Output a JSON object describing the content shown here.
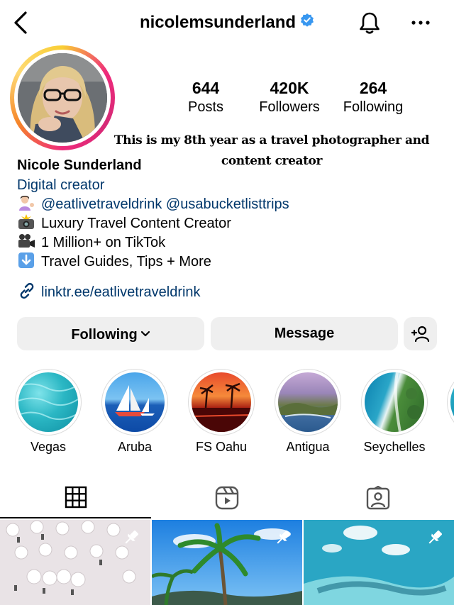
{
  "header": {
    "username": "nicolemsunderland",
    "verified": true,
    "icons": [
      "back-arrow-icon",
      "verified-badge-icon",
      "bell-icon",
      "more-dots-icon"
    ]
  },
  "stats": [
    {
      "value": "644",
      "label": "Posts"
    },
    {
      "value": "420K",
      "label": "Followers"
    },
    {
      "value": "264",
      "label": "Following"
    }
  ],
  "caption_overlay": "This is my 8th year as a travel photographer and content creator",
  "profile": {
    "name": "Nicole Sunderland",
    "category": "Digital creator",
    "bio": [
      {
        "emoji": "woman-tipping-hand-icon",
        "text": "@eatlivetraveldrink @usabucketlisttrips"
      },
      {
        "emoji": "camera-flash-icon",
        "text": "Luxury Travel Content Creator"
      },
      {
        "emoji": "video-camera-icon",
        "text": "1 Million+ on TikTok"
      },
      {
        "emoji": "down-arrow-icon",
        "text": "Travel Guides, Tips + More"
      }
    ],
    "link": "linktr.ee/eatlivetraveldrink"
  },
  "actions": {
    "following_label": "Following",
    "message_label": "Message"
  },
  "highlights": [
    {
      "label": "Vegas"
    },
    {
      "label": "Aruba"
    },
    {
      "label": "FS Oahu"
    },
    {
      "label": "Antigua"
    },
    {
      "label": "Seychelles"
    }
  ],
  "tabs": [
    "grid-icon",
    "reels-icon",
    "tagged-icon"
  ],
  "colors": {
    "link_blue": "#00376b",
    "verified_blue": "#3897f0",
    "button_gray": "#efefef"
  }
}
